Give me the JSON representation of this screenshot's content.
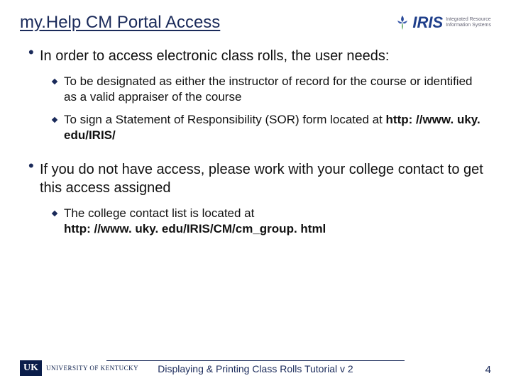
{
  "header": {
    "title": "my.Help CM Portal Access",
    "logo_text": "IRIS",
    "logo_sub1": "Integrated Resource",
    "logo_sub2": "Information Systems"
  },
  "bullets": [
    {
      "text": "In order to access electronic class rolls, the user needs:",
      "subs": [
        {
          "text": "To be designated as either the instructor of record for the course or identified as a valid appraiser of the course"
        },
        {
          "text": "To sign a Statement of Responsibility (SOR) form located at ",
          "link": "http: //www. uky. edu/IRIS/"
        }
      ]
    },
    {
      "text": "If you do not have access, please work with your college contact to get this access assigned",
      "subs": [
        {
          "text": "The college contact list is located at ",
          "link": "http: //www. uky. edu/IRIS/CM/cm_group. html"
        }
      ]
    }
  ],
  "footer": {
    "uk_box": "UK",
    "uk_text": "UNIVERSITY OF KENTUCKY",
    "caption": "Displaying & Printing Class Rolls Tutorial v 2",
    "page": "4"
  }
}
